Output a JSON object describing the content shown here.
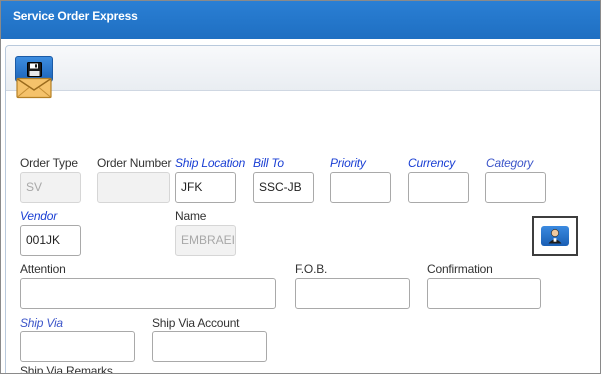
{
  "window": {
    "title": "Service Order Express"
  },
  "toolbar": {
    "save_icon": "floppy-disk-icon"
  },
  "icons": {
    "mail": "envelope-icon",
    "lookup": "person-lookup-icon"
  },
  "colors": {
    "title_bar": "#2478cc",
    "required_label": "#1a3fd4"
  },
  "form": {
    "order_type": {
      "label": "Order Type",
      "value": "SV"
    },
    "order_number": {
      "label": "Order Number",
      "value": ""
    },
    "ship_location": {
      "label": "Ship Location",
      "value": "JFK"
    },
    "bill_to": {
      "label": "Bill To",
      "value": "SSC-JB"
    },
    "priority": {
      "label": "Priority",
      "value": ""
    },
    "currency": {
      "label": "Currency",
      "value": ""
    },
    "category": {
      "label": "Category",
      "value": ""
    },
    "vendor": {
      "label": "Vendor",
      "value": "001JK"
    },
    "name": {
      "label": "Name",
      "value": "EMBRAEI"
    },
    "attention": {
      "label": "Attention",
      "value": ""
    },
    "fob": {
      "label": "F.O.B.",
      "value": ""
    },
    "confirmation": {
      "label": "Confirmation",
      "value": ""
    },
    "ship_via": {
      "label": "Ship Via",
      "value": ""
    },
    "ship_via_account": {
      "label": "Ship Via Account",
      "value": ""
    },
    "ship_via_remarks": {
      "label": "Ship Via Remarks"
    }
  }
}
